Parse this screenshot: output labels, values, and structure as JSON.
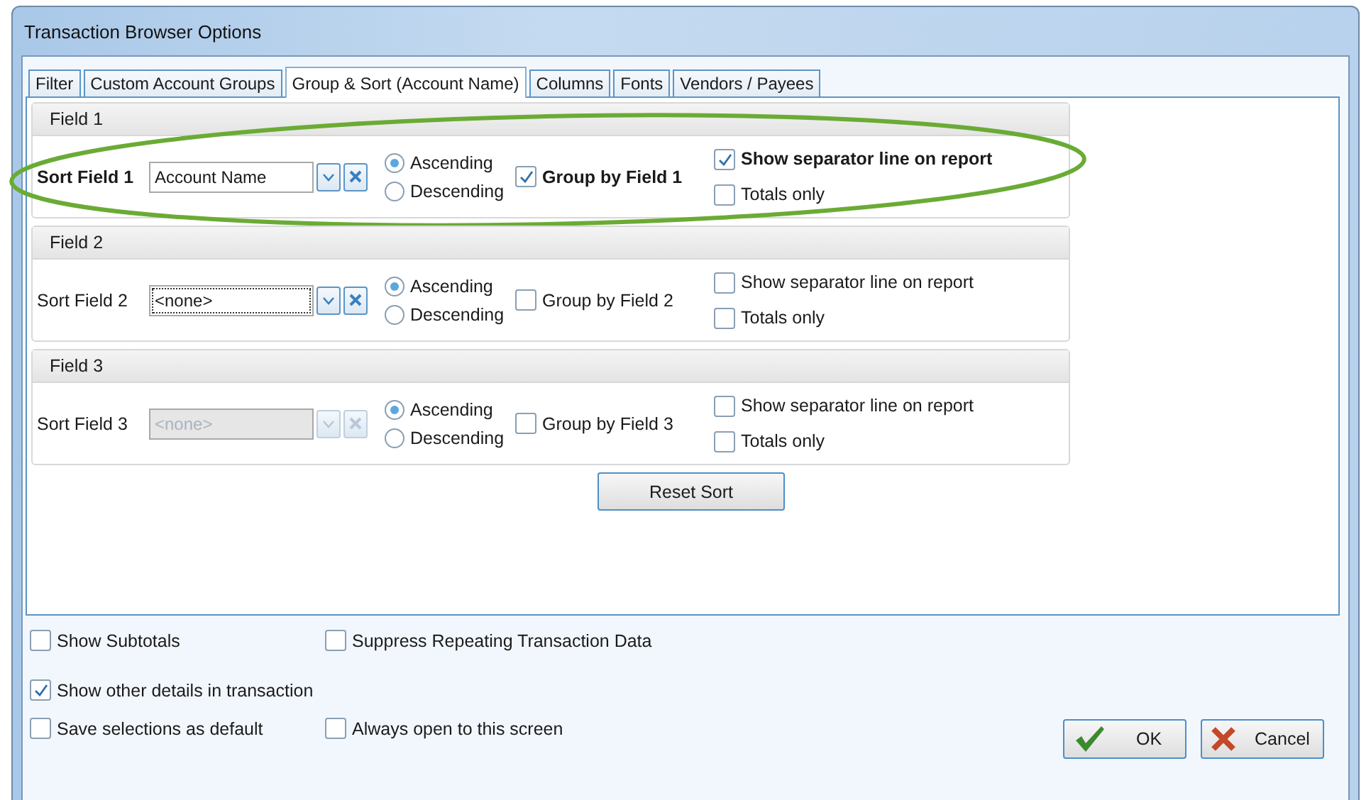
{
  "window": {
    "title": "Transaction Browser Options"
  },
  "tabs": [
    {
      "label": "Filter",
      "selected": false
    },
    {
      "label": "Custom Account Groups",
      "selected": false
    },
    {
      "label": "Group & Sort (Account Name)",
      "selected": true
    },
    {
      "label": "Columns",
      "selected": false
    },
    {
      "label": "Fonts",
      "selected": false
    },
    {
      "label": "Vendors / Payees",
      "selected": false
    }
  ],
  "field_groups": [
    {
      "heading": "Field 1",
      "label": "Sort Field 1",
      "value": "Account Name",
      "highlighted": true,
      "focused": false,
      "disabled": false,
      "order": [
        {
          "label": "Ascending",
          "selected": true
        },
        {
          "label": "Descending",
          "selected": false
        }
      ],
      "group_by": {
        "label": "Group by Field 1",
        "checked": true
      },
      "separator": {
        "label": "Show separator line on report",
        "checked": true
      },
      "totals_only": {
        "label": "Totals only",
        "checked": false
      }
    },
    {
      "heading": "Field 2",
      "label": "Sort Field 2",
      "value": "<none>",
      "highlighted": false,
      "focused": true,
      "disabled": false,
      "order": [
        {
          "label": "Ascending",
          "selected": true
        },
        {
          "label": "Descending",
          "selected": false
        }
      ],
      "group_by": {
        "label": "Group by Field 2",
        "checked": false
      },
      "separator": {
        "label": "Show separator line on report",
        "checked": false
      },
      "totals_only": {
        "label": "Totals only",
        "checked": false
      }
    },
    {
      "heading": "Field 3",
      "label": "Sort Field 3",
      "value": "<none>",
      "highlighted": false,
      "focused": false,
      "disabled": true,
      "order": [
        {
          "label": "Ascending",
          "selected": true
        },
        {
          "label": "Descending",
          "selected": false
        }
      ],
      "group_by": {
        "label": "Group by Field 3",
        "checked": false
      },
      "separator": {
        "label": "Show separator line on report",
        "checked": false
      },
      "totals_only": {
        "label": "Totals only",
        "checked": false
      }
    }
  ],
  "reset_button": "Reset Sort",
  "options": [
    [
      {
        "label": "Show Subtotals",
        "checked": false
      },
      {
        "label": "Suppress Repeating Transaction Data",
        "checked": false
      }
    ],
    [
      {
        "label": "Show other details in transaction",
        "checked": true
      }
    ],
    [
      {
        "label": "Save selections as default",
        "checked": false
      },
      {
        "label": "Always open to this screen",
        "checked": false
      }
    ]
  ],
  "buttons": [
    {
      "label": "OK",
      "kind": "ok"
    },
    {
      "label": "Cancel",
      "kind": "cancel"
    }
  ]
}
